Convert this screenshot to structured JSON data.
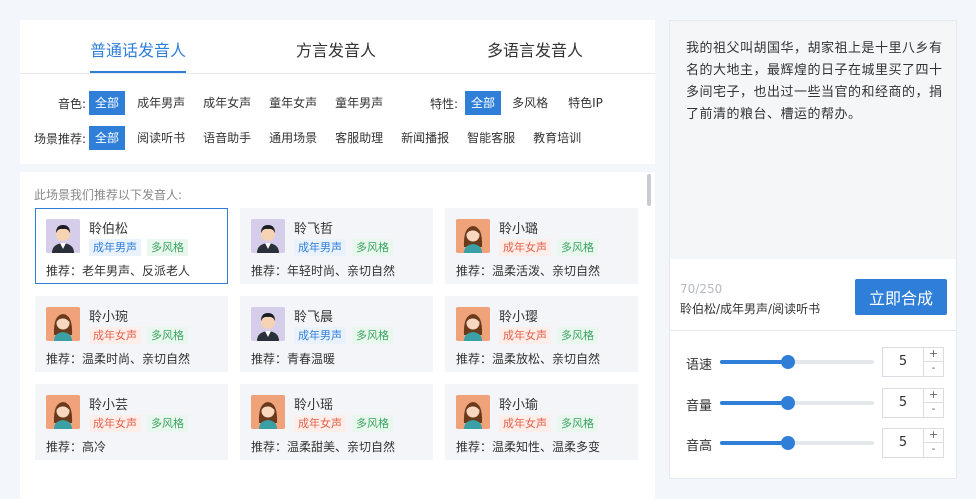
{
  "tabs": [
    "普通话发音人",
    "方言发音人",
    "多语言发音人"
  ],
  "filters": {
    "timbre_label": "音色:",
    "timbre_options": [
      "全部",
      "成年男声",
      "成年女声",
      "童年女声",
      "童年男声"
    ],
    "feature_label": "特性:",
    "feature_options": [
      "全部",
      "多风格",
      "特色IP"
    ],
    "scene_label": "场景推荐:",
    "scene_options": [
      "全部",
      "阅读听书",
      "语音助手",
      "通用场景",
      "客服助理",
      "新闻播报",
      "智能客服",
      "教育培训"
    ]
  },
  "list": {
    "hint": "此场景我们推荐以下发音人:",
    "speakers": [
      {
        "name": "聆伯松",
        "gender_tag": "成年男声",
        "style_tag": "多风格",
        "recommend": "推荐：老年男声、反派老人",
        "gender": "male"
      },
      {
        "name": "聆飞哲",
        "gender_tag": "成年男声",
        "style_tag": "多风格",
        "recommend": "推荐：年轻时尚、亲切自然",
        "gender": "male"
      },
      {
        "name": "聆小璐",
        "gender_tag": "成年女声",
        "style_tag": "多风格",
        "recommend": "推荐：温柔活泼、亲切自然",
        "gender": "female"
      },
      {
        "name": "聆小琬",
        "gender_tag": "成年女声",
        "style_tag": "多风格",
        "recommend": "推荐：温柔时尚、亲切自然",
        "gender": "female"
      },
      {
        "name": "聆飞晨",
        "gender_tag": "成年男声",
        "style_tag": "多风格",
        "recommend": "推荐：青春温暖",
        "gender": "male"
      },
      {
        "name": "聆小璎",
        "gender_tag": "成年女声",
        "style_tag": "多风格",
        "recommend": "推荐：温柔放松、亲切自然",
        "gender": "female"
      },
      {
        "name": "聆小芸",
        "gender_tag": "成年女声",
        "style_tag": "多风格",
        "recommend": "推荐：高冷",
        "gender": "female"
      },
      {
        "name": "聆小瑶",
        "gender_tag": "成年女声",
        "style_tag": "多风格",
        "recommend": "推荐：温柔甜美、亲切自然",
        "gender": "female"
      },
      {
        "name": "聆小瑜",
        "gender_tag": "成年女声",
        "style_tag": "多风格",
        "recommend": "推荐：温柔知性、温柔多变",
        "gender": "female"
      }
    ]
  },
  "editor": {
    "text": "我的祖父叫胡国华，胡家祖上是十里八乡有名的大地主，最辉煌的日子在城里买了四十多间宅子，也出过一些当官的和经商的，捐了前清的粮台、槽运的帮办。",
    "counter": "70/250",
    "selection_summary": "聆伯松/成年男声/阅读听书",
    "synth_button": "立即合成"
  },
  "sliders": [
    {
      "label": "语速",
      "value": "5",
      "level_percent": 44
    },
    {
      "label": "音量",
      "value": "5",
      "level_percent": 44
    },
    {
      "label": "音高",
      "value": "5",
      "level_percent": 44
    }
  ],
  "stepper_symbols": {
    "plus": "+",
    "minus": "-"
  },
  "colors": {
    "accent": "#2f7fd9",
    "male_tag": "#2f7fd9",
    "female_tag": "#e2614a",
    "style_tag": "#3aa45f"
  }
}
